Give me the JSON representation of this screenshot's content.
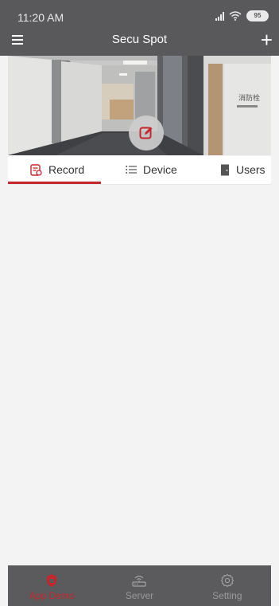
{
  "status_bar": {
    "time": "11:20 AM",
    "battery": "95"
  },
  "app_bar": {
    "title": "Secu Spot",
    "menu_icon": "hamburger-icon",
    "add_icon": "plus-icon"
  },
  "tabs": [
    {
      "label": "Record",
      "icon": "record-icon",
      "active": true
    },
    {
      "label": "Device",
      "icon": "list-icon",
      "active": false
    },
    {
      "label": "Users",
      "icon": "door-icon",
      "active": false
    }
  ],
  "bottom_nav": [
    {
      "label": "App Demo",
      "icon": "home-shield-icon",
      "active": true
    },
    {
      "label": "Server",
      "icon": "router-icon",
      "active": false
    },
    {
      "label": "Setting",
      "icon": "gear-icon",
      "active": false
    }
  ],
  "colors": {
    "accent": "#c2272d",
    "bar": "#59595c",
    "background": "#f3f3f4"
  }
}
